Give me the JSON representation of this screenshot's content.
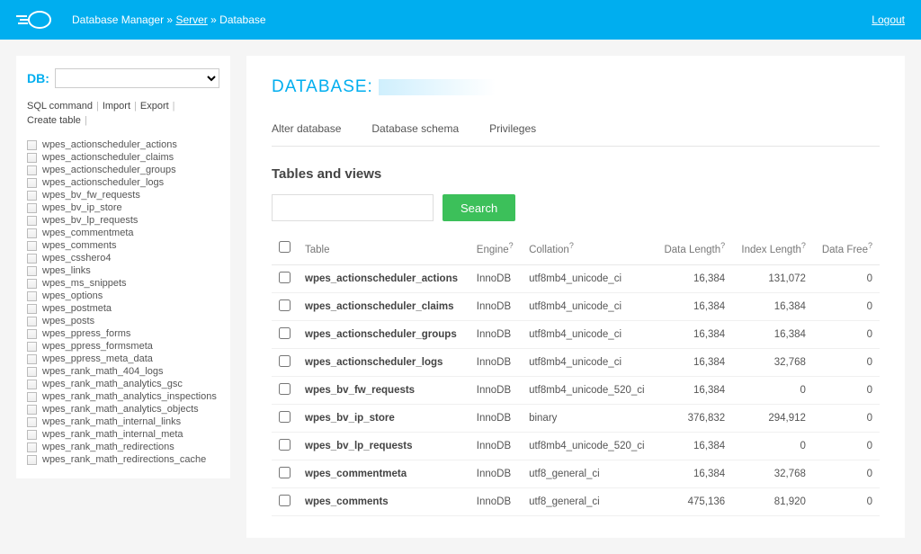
{
  "header": {
    "app_name": "Database Manager",
    "bc_sep": "»",
    "bc_server": "Server",
    "bc_database": "Database",
    "logout": "Logout"
  },
  "sidebar": {
    "db_label": "DB:",
    "actions": {
      "sql": "SQL command",
      "import": "Import",
      "export": "Export",
      "create": "Create table"
    },
    "tables": [
      "wpes_actionscheduler_actions",
      "wpes_actionscheduler_claims",
      "wpes_actionscheduler_groups",
      "wpes_actionscheduler_logs",
      "wpes_bv_fw_requests",
      "wpes_bv_ip_store",
      "wpes_bv_lp_requests",
      "wpes_commentmeta",
      "wpes_comments",
      "wpes_csshero4",
      "wpes_links",
      "wpes_ms_snippets",
      "wpes_options",
      "wpes_postmeta",
      "wpes_posts",
      "wpes_ppress_forms",
      "wpes_ppress_formsmeta",
      "wpes_ppress_meta_data",
      "wpes_rank_math_404_logs",
      "wpes_rank_math_analytics_gsc",
      "wpes_rank_math_analytics_inspections",
      "wpes_rank_math_analytics_objects",
      "wpes_rank_math_internal_links",
      "wpes_rank_math_internal_meta",
      "wpes_rank_math_redirections",
      "wpes_rank_math_redirections_cache"
    ]
  },
  "main": {
    "title_label": "DATABASE:",
    "tabs": {
      "alter": "Alter database",
      "schema": "Database schema",
      "privileges": "Privileges"
    },
    "section_title": "Tables and views",
    "search_btn": "Search",
    "columns": {
      "table": "Table",
      "engine": "Engine",
      "collation": "Collation",
      "data_length": "Data Length",
      "index_length": "Index Length",
      "data_free": "Data Free"
    },
    "rows": [
      {
        "table": "wpes_actionscheduler_actions",
        "engine": "InnoDB",
        "collation": "utf8mb4_unicode_ci",
        "data_length": "16,384",
        "index_length": "131,072",
        "data_free": "0"
      },
      {
        "table": "wpes_actionscheduler_claims",
        "engine": "InnoDB",
        "collation": "utf8mb4_unicode_ci",
        "data_length": "16,384",
        "index_length": "16,384",
        "data_free": "0"
      },
      {
        "table": "wpes_actionscheduler_groups",
        "engine": "InnoDB",
        "collation": "utf8mb4_unicode_ci",
        "data_length": "16,384",
        "index_length": "16,384",
        "data_free": "0"
      },
      {
        "table": "wpes_actionscheduler_logs",
        "engine": "InnoDB",
        "collation": "utf8mb4_unicode_ci",
        "data_length": "16,384",
        "index_length": "32,768",
        "data_free": "0"
      },
      {
        "table": "wpes_bv_fw_requests",
        "engine": "InnoDB",
        "collation": "utf8mb4_unicode_520_ci",
        "data_length": "16,384",
        "index_length": "0",
        "data_free": "0"
      },
      {
        "table": "wpes_bv_ip_store",
        "engine": "InnoDB",
        "collation": "binary",
        "data_length": "376,832",
        "index_length": "294,912",
        "data_free": "0"
      },
      {
        "table": "wpes_bv_lp_requests",
        "engine": "InnoDB",
        "collation": "utf8mb4_unicode_520_ci",
        "data_length": "16,384",
        "index_length": "0",
        "data_free": "0"
      },
      {
        "table": "wpes_commentmeta",
        "engine": "InnoDB",
        "collation": "utf8_general_ci",
        "data_length": "16,384",
        "index_length": "32,768",
        "data_free": "0"
      },
      {
        "table": "wpes_comments",
        "engine": "InnoDB",
        "collation": "utf8_general_ci",
        "data_length": "475,136",
        "index_length": "81,920",
        "data_free": "0"
      }
    ]
  }
}
